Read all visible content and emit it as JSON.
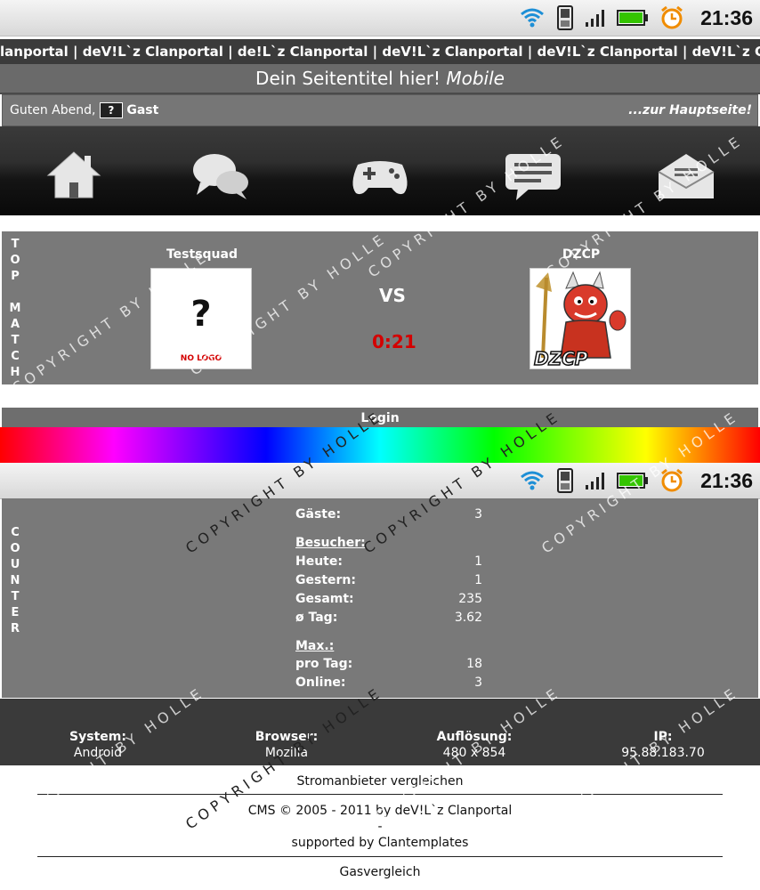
{
  "status_bar": {
    "time": "21:36"
  },
  "ticker": {
    "text": "lanportal | deV!L`z Clanportal | de!L`z Clanportal | deV!L`z Clanportal | deV!L`z Clanportal | deV!L`z Clanportal | deV!L`z"
  },
  "site_title": {
    "text": "Dein Seitentitel hier!",
    "suffix": "Mobile"
  },
  "greeting": {
    "prefix": "Guten Abend,",
    "user": "Gast",
    "home_link": "...zur Hauptseite!"
  },
  "nav": {
    "items": [
      {
        "label": "home-icon"
      },
      {
        "label": "chat-icon"
      },
      {
        "label": "gamepad-icon"
      },
      {
        "label": "message-icon"
      },
      {
        "label": "mail-icon"
      }
    ]
  },
  "top_match": {
    "side_label": [
      "T",
      "O",
      "P",
      "",
      "M",
      "A",
      "T",
      "C",
      "H"
    ],
    "team1": "Testsquad",
    "team1_logo_text": "?",
    "team1_logo_caption": "NO LOGO",
    "vs": "VS",
    "score": "0:21",
    "team2": "DZCP",
    "team2_logo_caption": "DZCP"
  },
  "login": {
    "label": "Login"
  },
  "counter": {
    "side_label": [
      "C",
      "O",
      "U",
      "N",
      "T",
      "E",
      "R"
    ],
    "online_rows": [
      {
        "label": "Gäste:",
        "value": "3"
      }
    ],
    "visitors_head": "Besucher:",
    "visitors": [
      {
        "label": "Heute:",
        "value": "1"
      },
      {
        "label": "Gestern:",
        "value": "1"
      },
      {
        "label": "Gesamt:",
        "value": "235"
      },
      {
        "label": "ø Tag:",
        "value": "3.62"
      }
    ],
    "max_head": "Max.:",
    "max": [
      {
        "label": "pro Tag:",
        "value": "18"
      },
      {
        "label": "Online:",
        "value": "3"
      }
    ]
  },
  "footer_stats": [
    {
      "label": "System:",
      "value": "Android"
    },
    {
      "label": "Browser:",
      "value": "Mozilla"
    },
    {
      "label": "Auflösung:",
      "value": "480 x 854"
    },
    {
      "label": "IP:",
      "value": "95.88.183.70"
    }
  ],
  "footer_links": {
    "link1": "Stromanbieter vergleichen",
    "cms": "CMS © 2005 - 2011 by deV!L`z Clanportal",
    "dash": "-",
    "supported": "supported by Clantemplates",
    "link2": "Gasvergleich"
  },
  "watermark": "COPYRIGHT BY HOLLE"
}
